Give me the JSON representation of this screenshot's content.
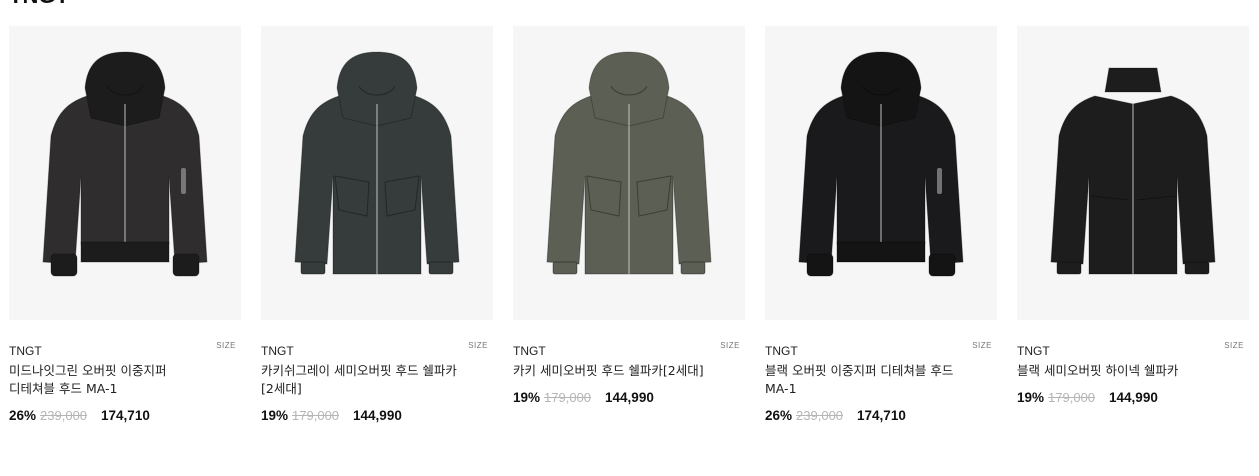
{
  "section": {
    "title": "TNGT"
  },
  "products": [
    {
      "brand": "TNGT",
      "name": "미드나잇그린 오버핏 이중지퍼 디테쳐블 후드 MA-1",
      "discount": "26%",
      "original_price": "239,000",
      "price": "174,710",
      "size_label": "SIZE",
      "jacket_color": "#2f2d2e",
      "hood_color": "#1c1c1c"
    },
    {
      "brand": "TNGT",
      "name": "카키쉬그레이 세미오버핏 후드 쉘파카[2세대]",
      "discount": "19%",
      "original_price": "179,000",
      "price": "144,990",
      "size_label": "SIZE",
      "jacket_color": "#353c3b",
      "hood_color": "#353c3b"
    },
    {
      "brand": "TNGT",
      "name": "카키 세미오버핏 후드 쉘파카[2세대]",
      "discount": "19%",
      "original_price": "179,000",
      "price": "144,990",
      "size_label": "SIZE",
      "jacket_color": "#5b5f54",
      "hood_color": "#5b5f54"
    },
    {
      "brand": "TNGT",
      "name": "블랙 오버핏 이중지퍼 디테쳐블 후드 MA-1",
      "discount": "26%",
      "original_price": "239,000",
      "price": "174,710",
      "size_label": "SIZE",
      "jacket_color": "#1a1a1c",
      "hood_color": "#141414"
    },
    {
      "brand": "TNGT",
      "name": "블랙 세미오버핏 하이넥 쉘파카",
      "discount": "19%",
      "original_price": "179,000",
      "price": "144,990",
      "size_label": "SIZE",
      "jacket_color": "#1d1d1e",
      "hood_color": "#1d1d1e"
    }
  ]
}
